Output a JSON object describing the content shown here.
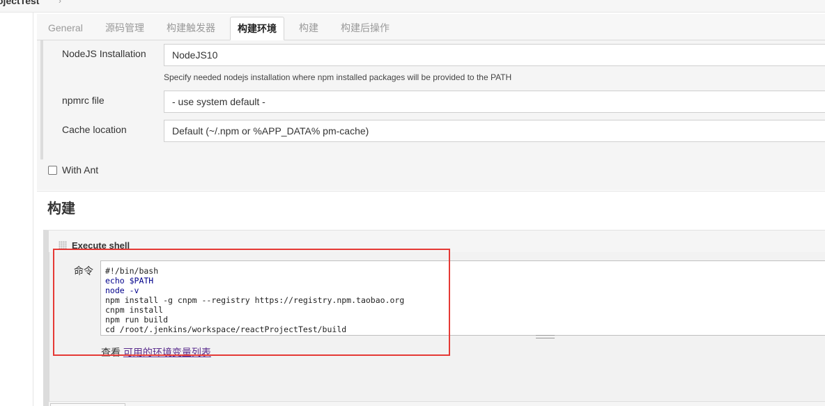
{
  "breadcrumb": {
    "project": "ojectTest",
    "separator": "›"
  },
  "tabs": [
    {
      "label": "General",
      "active": false
    },
    {
      "label": "源码管理",
      "active": false
    },
    {
      "label": "构建触发器",
      "active": false
    },
    {
      "label": "构建环境",
      "active": true
    },
    {
      "label": "构建",
      "active": false
    },
    {
      "label": "构建后操作",
      "active": false
    }
  ],
  "nodejs": {
    "installation_label": "NodeJS Installation",
    "installation_value": "NodeJS10",
    "installation_hint": "Specify needed nodejs installation where npm installed packages will be provided to the PATH",
    "npmrc_label": "npmrc file",
    "npmrc_value": "- use system default -",
    "cache_label": "Cache location",
    "cache_value": "Default (~/.npm or %APP_DATA% pm-cache)"
  },
  "with_ant": {
    "label": "With Ant",
    "checked": false
  },
  "build": {
    "title": "构建",
    "step_title": "Execute shell",
    "command_label": "命令",
    "command_lines": [
      "#!/bin/bash",
      "echo $PATH",
      "node -v",
      "npm install -g cnpm --registry https://registry.npm.taobao.org",
      "cnpm install",
      "npm run build",
      "cd /root/.jenkins/workspace/reactProjectTest/build"
    ],
    "env_prefix": "查看 ",
    "env_link": "可用的环境变量列表"
  },
  "colors": {
    "highlight_box": "#e53935",
    "link": "#5b2d8e",
    "keyword": "#00008b"
  }
}
